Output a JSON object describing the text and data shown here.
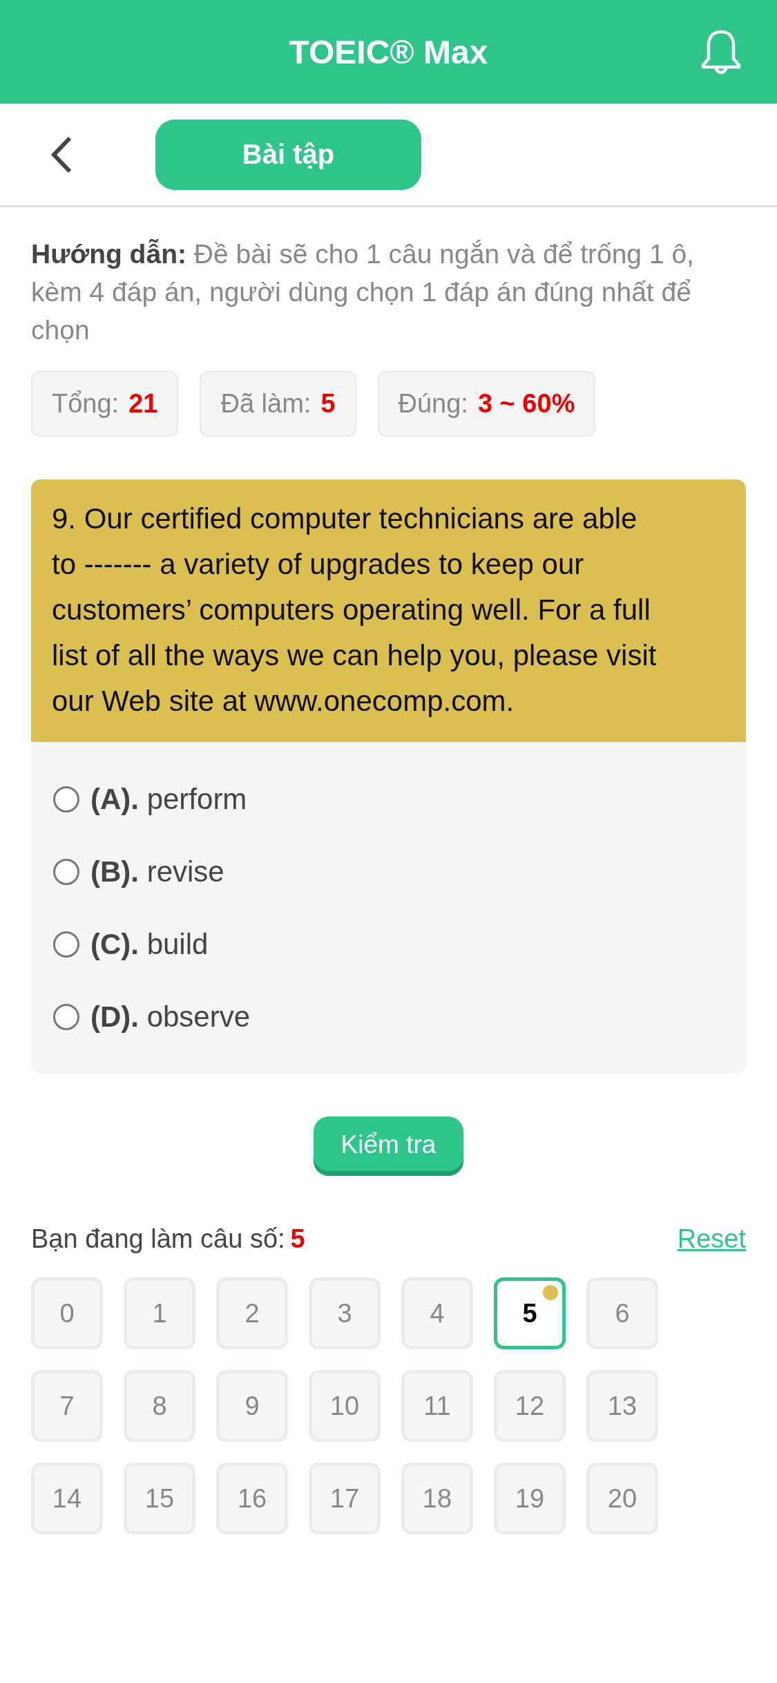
{
  "app_bar": {
    "title": "TOEIC® Max"
  },
  "toolbar": {
    "tab_button": "Bài tập"
  },
  "instructions": "**Hướng dẫn:** Đề bài sẽ cho 1 câu ngắn và để trống 1 ô, kèm 4 đáp án, người dùng chọn 1 đáp án đúng nhất để chọn",
  "stats": [
    {
      "label": "Tổng:",
      "value": "21"
    },
    {
      "label": "Đã làm:",
      "value": "5"
    },
    {
      "label": "Đúng:",
      "value": "3 ~ 60%"
    }
  ],
  "question": {
    "text": "9. Our certified computer technicians are able to ------- a variety of upgrades to keep our customers’ computers operating well. For a full list of all the ways we can help you, please visit our Web site at www.onecomp.com.",
    "options": [
      {
        "label": "**(A).** perform",
        "selected": false
      },
      {
        "label": "**(B).** revise",
        "selected": false
      },
      {
        "label": "**(C).** build",
        "selected": false
      },
      {
        "label": "**(D).** observe",
        "selected": false
      }
    ]
  },
  "check_button": "Kiểm tra",
  "progress": {
    "label": "Bạn đang làm câu số:",
    "value": "5",
    "reset_link": "Reset"
  },
  "question_grid": [
    {
      "label": "0",
      "selected": false,
      "marked": false
    },
    {
      "label": "1",
      "selected": false,
      "marked": false
    },
    {
      "label": "2",
      "selected": false,
      "marked": false
    },
    {
      "label": "3",
      "selected": false,
      "marked": false
    },
    {
      "label": "4",
      "selected": false,
      "marked": false
    },
    {
      "label": "5",
      "selected": true,
      "marked": true
    },
    {
      "label": "6",
      "selected": false,
      "marked": false
    },
    {
      "label": "7",
      "selected": false,
      "marked": false
    },
    {
      "label": "8",
      "selected": false,
      "marked": false
    },
    {
      "label": "9",
      "selected": false,
      "marked": false
    },
    {
      "label": "10",
      "selected": false,
      "marked": false
    },
    {
      "label": "11",
      "selected": false,
      "marked": false
    },
    {
      "label": "12",
      "selected": false,
      "marked": false
    },
    {
      "label": "13",
      "selected": false,
      "marked": false
    },
    {
      "label": "14",
      "selected": false,
      "marked": false
    },
    {
      "label": "15",
      "selected": false,
      "marked": false
    },
    {
      "label": "16",
      "selected": false,
      "marked": false
    },
    {
      "label": "17",
      "selected": false,
      "marked": false
    },
    {
      "label": "18",
      "selected": false,
      "marked": false
    },
    {
      "label": "19",
      "selected": false,
      "marked": false
    },
    {
      "label": "20",
      "selected": false,
      "marked": false
    }
  ]
}
